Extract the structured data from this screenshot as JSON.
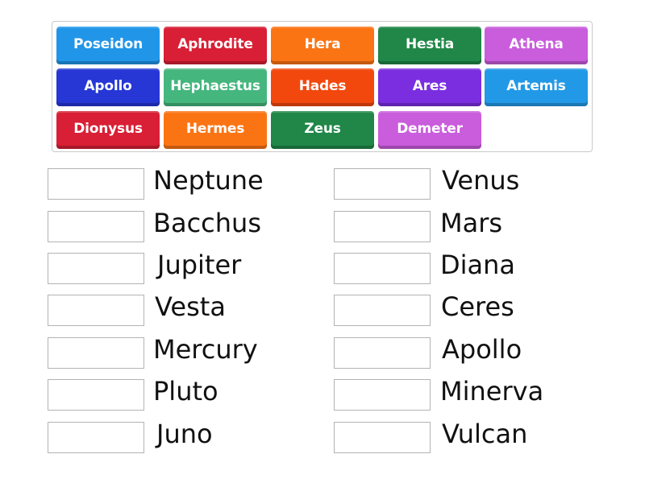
{
  "tile_bank": {
    "tiles": [
      {
        "label": "Poseidon",
        "color": "#2196e8"
      },
      {
        "label": "Aphrodite",
        "color": "#d81f35"
      },
      {
        "label": "Hera",
        "color": "#fb7414"
      },
      {
        "label": "Hestia",
        "color": "#208748"
      },
      {
        "label": "Athena",
        "color": "#c95ddc"
      },
      {
        "label": "Apollo",
        "color": "#2637d6"
      },
      {
        "label": "Hephaestus",
        "color": "#45b67e"
      },
      {
        "label": "Hades",
        "color": "#f2480e"
      },
      {
        "label": "Ares",
        "color": "#7a2ee0"
      },
      {
        "label": "Artemis",
        "color": "#2299e6"
      },
      {
        "label": "Dionysus",
        "color": "#d81f35"
      },
      {
        "label": "Hermes",
        "color": "#fb7414"
      },
      {
        "label": "Zeus",
        "color": "#208748"
      },
      {
        "label": "Demeter",
        "color": "#c95ddc"
      }
    ]
  },
  "targets": {
    "left": [
      {
        "label": "Neptune",
        "answer": ""
      },
      {
        "label": "Bacchus",
        "answer": ""
      },
      {
        "label": "Jupiter",
        "answer": ""
      },
      {
        "label": "Vesta",
        "answer": ""
      },
      {
        "label": "Mercury",
        "answer": ""
      },
      {
        "label": "Pluto",
        "answer": ""
      },
      {
        "label": "Juno",
        "answer": ""
      }
    ],
    "right": [
      {
        "label": "Venus",
        "answer": ""
      },
      {
        "label": "Mars",
        "answer": ""
      },
      {
        "label": "Diana",
        "answer": ""
      },
      {
        "label": "Ceres",
        "answer": ""
      },
      {
        "label": "Apollo",
        "answer": ""
      },
      {
        "label": "Minerva",
        "answer": ""
      },
      {
        "label": "Vulcan",
        "answer": ""
      }
    ]
  }
}
